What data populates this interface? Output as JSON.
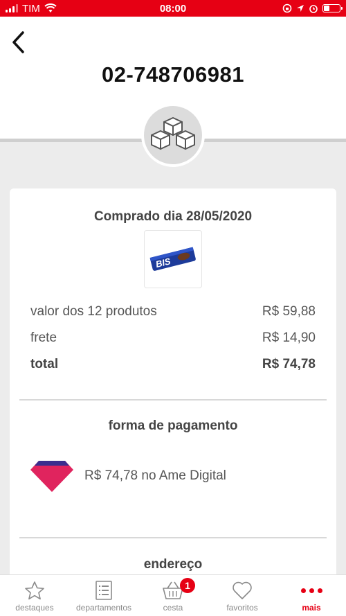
{
  "status_bar": {
    "carrier": "TIM",
    "time": "08:00"
  },
  "header": {
    "order_number": "02-748706981"
  },
  "order": {
    "purchase_date_label": "Comprado dia 28/05/2020",
    "product_image": "BIS chocolate wafer pack",
    "product_brand_text": "BIS",
    "items_label": "valor dos 12 produtos",
    "items_value": "R$ 59,88",
    "shipping_label": "frete",
    "shipping_value": "R$ 14,90",
    "total_label": "total",
    "total_value": "R$ 74,78"
  },
  "payment": {
    "title": "forma de pagamento",
    "icon": "ame-digital-logo",
    "description": "R$ 74,78 no Ame Digital"
  },
  "address": {
    "title": "endereço"
  },
  "tab_bar": {
    "items": [
      {
        "label": "destaques",
        "icon": "star-icon"
      },
      {
        "label": "departamentos",
        "icon": "list-icon"
      },
      {
        "label": "cesta",
        "icon": "basket-icon",
        "badge": "1"
      },
      {
        "label": "favoritos",
        "icon": "heart-icon"
      },
      {
        "label": "mais",
        "icon": "more-dots-icon",
        "active": true
      }
    ]
  },
  "colors": {
    "brand_red": "#e60014",
    "ame_pink": "#e0245e",
    "ame_blue": "#3a2e8f"
  }
}
